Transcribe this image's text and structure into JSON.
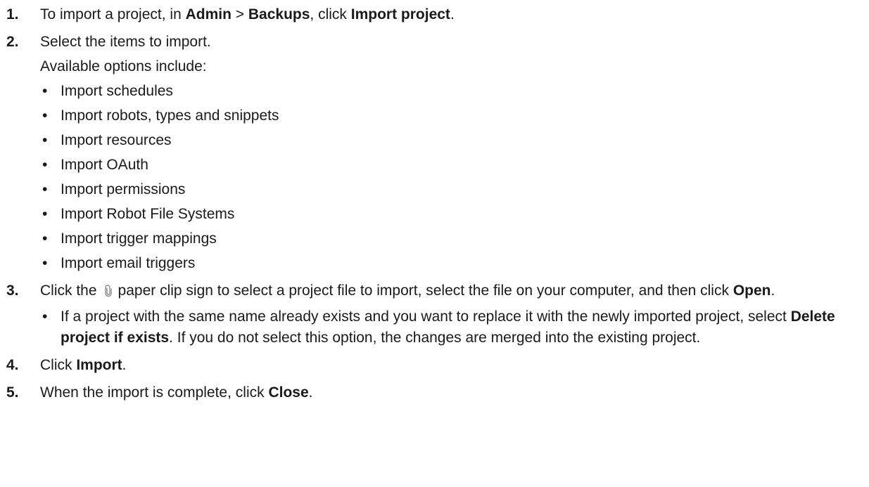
{
  "steps": [
    {
      "number": "1.",
      "pre": "To import a project, in ",
      "b1": "Admin",
      "mid1": " > ",
      "b2": "Backups",
      "mid2": ", click ",
      "b3": "Import project",
      "post": "."
    },
    {
      "number": "2.",
      "text": "Select the items to import.",
      "sub": "Available options include:",
      "options": [
        "Import schedules",
        "Import robots, types and snippets",
        "Import resources",
        "Import OAuth",
        "Import permissions",
        "Import Robot File Systems",
        "Import trigger mappings",
        "Import email triggers"
      ]
    },
    {
      "number": "3.",
      "pre": "Click the",
      "icon": "paper-clip-icon",
      "mid": "paper clip sign to select a project file to import, select the file on your computer, and then click ",
      "b1": "Open",
      "post": ".",
      "note_pre": "If a project with the same name already exists and you want to replace it with the newly imported project, select ",
      "note_b": "Delete project if exists",
      "note_post": ". If you do not select this option, the changes are merged into the existing project."
    },
    {
      "number": "4.",
      "pre": "Click ",
      "b1": "Import",
      "post": "."
    },
    {
      "number": "5.",
      "pre": "When the import is complete, click ",
      "b1": "Close",
      "post": "."
    }
  ],
  "bullet_char": "•"
}
